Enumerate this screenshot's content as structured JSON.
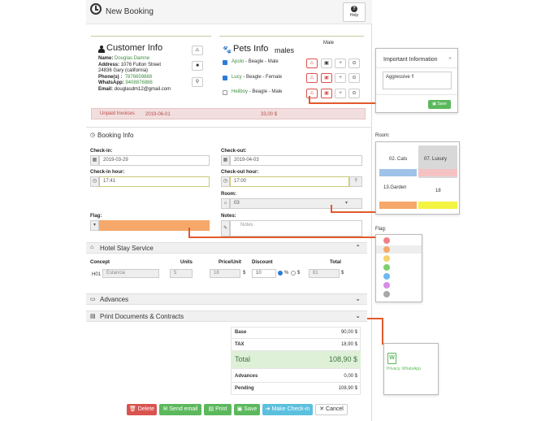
{
  "header": {
    "title": "New Booking",
    "help_label": "Help"
  },
  "customer": {
    "heading": "Customer Info",
    "name_label": "Name:",
    "name": "Douglas Damne",
    "address_label": "Address:",
    "address": "1076 Fulton Street",
    "city": "24836 Gary (california)",
    "phone_label": "Phone(s) :",
    "phone": "7876659888",
    "whatsapp_label": "WhatsApp:",
    "whatsapp": "9408876888",
    "email_label": "Email:",
    "email": "douglasdm12@gmail.com"
  },
  "pets": {
    "heading": "Pets Info",
    "overlap_text": "males",
    "top_text": "Male",
    "rows": [
      {
        "name": "Apolo",
        "detail": " - Beagle - Male",
        "checked": true
      },
      {
        "name": "Lucy",
        "detail": " - Beagle - Female",
        "checked": true
      },
      {
        "name": "Heilboy",
        "detail": " - Beagle - ",
        "extra": "Male",
        "checked": false
      }
    ]
  },
  "unpaid": {
    "label": "Unpaid Invoices",
    "date": "2019-06-01",
    "amount": "33,00 $"
  },
  "booking": {
    "heading": "Booking Info",
    "checkin_label": "Check-in:",
    "checkin": "2019-03-29",
    "checkout_label": "Check-out:",
    "checkout": "2019-04-03",
    "checkin_hour_label": "Check-in hour:",
    "checkin_hour": "17:41",
    "checkout_hour_label": "Check-out hour:",
    "checkout_hour": "17:00",
    "room_label": "Room:",
    "room": "03",
    "flag_label": "Flag:",
    "notes_label": "Notes:",
    "notes_placeholder": "Notes"
  },
  "hotel_stay": {
    "heading": "Hotel Stay Service",
    "col_concept": "Concept",
    "col_units": "Units",
    "col_price": "Price/Unit",
    "col_discount": "Discount",
    "col_total": "Total",
    "row_code": "H01",
    "row_concept": "Estancia",
    "row_units": "5",
    "row_price": "18",
    "row_currency": "$",
    "row_discount": "10",
    "pct": "%",
    "dollar": "$",
    "row_total": "81"
  },
  "advances": {
    "heading": "Advances"
  },
  "print_docs": {
    "heading": "Print Documents & Contracts"
  },
  "totals": {
    "base_label": "Base",
    "base": "90,00 $",
    "tax_label": "TAX",
    "tax": "18,90 $",
    "total_label": "Total",
    "total": "108,90 $",
    "advances_label": "Advances",
    "advances": "0,00 $",
    "pending_label": "Pending",
    "pending": "108,90 $"
  },
  "actions": {
    "delete": "Delete",
    "send_email": "Send email",
    "print": "Print",
    "save": "Save",
    "make_checkin": "Make Check-in",
    "cancel": "Cancel"
  },
  "important_popup": {
    "title": "Important Information",
    "close": "×",
    "text": "Aggressive !!",
    "save": "Save"
  },
  "room_popup": {
    "label": "Room:",
    "rooms": [
      {
        "name": "02. Cats",
        "bar": "#9fc3e8"
      },
      {
        "name": "07. Luxury",
        "bar": "#f4c2c2"
      },
      {
        "name": "13.Garden",
        "bar": "#f5a86a"
      },
      {
        "name": "18",
        "bar": "#f4f442"
      }
    ]
  },
  "flag_popup": {
    "label": "Flag:",
    "colors": [
      "#f0808a",
      "#f5a86a",
      "#f5d26a",
      "#7fcf6e",
      "#6fb8f0",
      "#d48ee6",
      "#a8a8a8"
    ]
  },
  "doc_popup": {
    "label": "Privacy. WhatsApp",
    "icon_letter": "W"
  },
  "colors": {
    "accent_orange": "#e15a2b",
    "danger": "#d9534f",
    "success": "#5cb85c",
    "info": "#5bc0de",
    "flag_field": "#f5a86a"
  }
}
